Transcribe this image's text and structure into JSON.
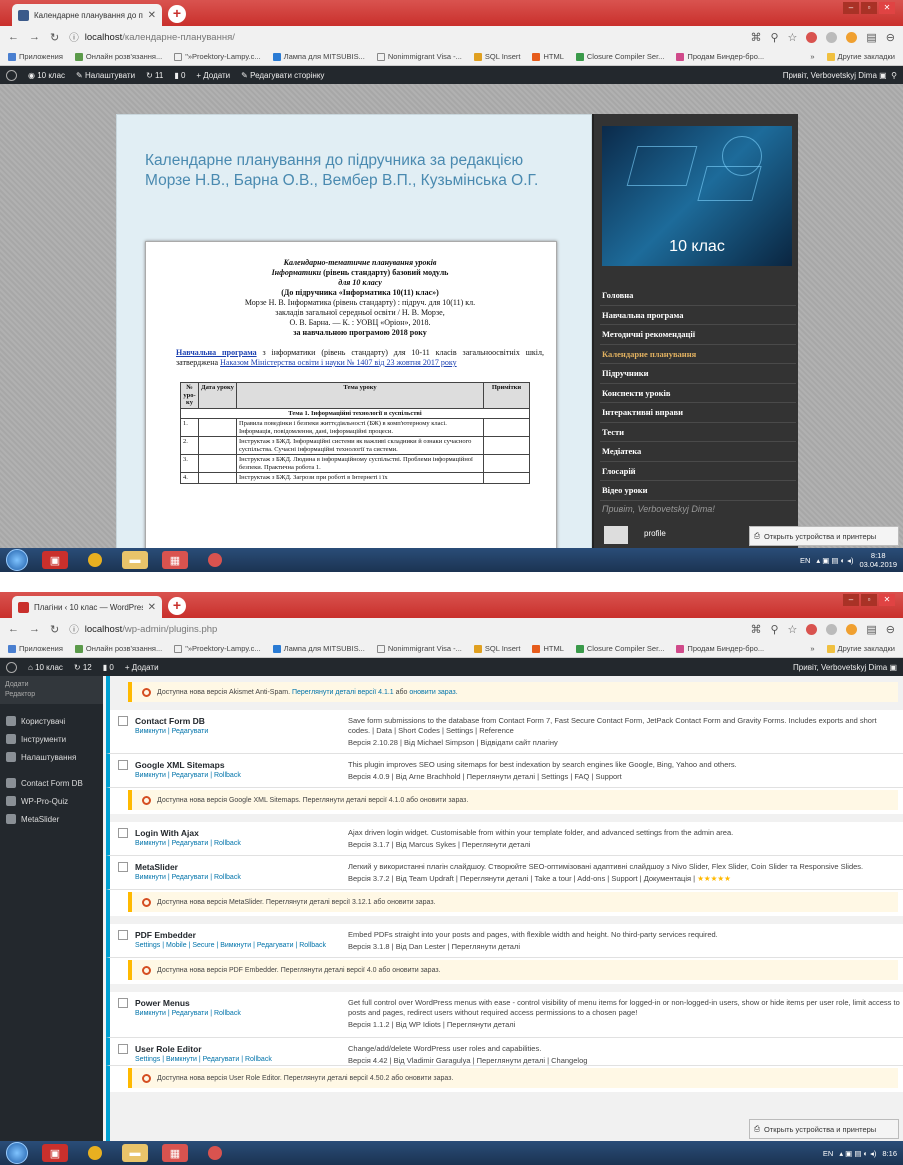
{
  "shot1": {
    "tab_title": "Календарне планування до підру...",
    "url_host": "localhost",
    "url_path": "/календарне-планування/",
    "bookmarks": [
      "Приложения",
      "Онлайн розв'язання...",
      "\"»Proektory-Lampy.c...",
      "Лампа для MITSUBIS...",
      "Nonimmigrant Visa -...",
      "SQL Insert",
      "HTML",
      "Closure Compiler Ser...",
      "Продам Биндер-бро...",
      "»",
      "Другие закладки"
    ],
    "adminbar": {
      "site": "10 клас",
      "customize": "Налаштувати",
      "updates": "11",
      "comments": "0",
      "new": "+ Додати",
      "edit": "Редагувати сторінку",
      "greeting": "Привіт, Verbovetskyj Dima"
    },
    "site_title": "Календарне планування до підручника за редакцією Морзе Н.В., Барна О.В., Вембер В.П., Кузьмінська О.Г.",
    "doc": {
      "h1": "Календарно-тематичне планування уроків",
      "h2a": "Інформатики",
      "h2b": " (рівень стандарту) базовий модуль",
      "h3": "для 10 класу",
      "h4": "(До підручника «Інформатика 10(11) клас»)",
      "h5": "Морзе Н. В. Інформатика (рівень стандарту) : підруч. для 10(11) кл.",
      "h6": "закладів загальної середньої освіти / Н. В. Морзе,",
      "h7": "О. В. Барна. — К. : УОВЦ «Оріон», 2018.",
      "h8": "за навчальною програмою 2018 року",
      "intro_link": "Навчальна програма",
      "intro_mid": " з інформатики (рівень стандарту) для 10-11 класів загальноосвітніх шкіл, затверджена ",
      "intro_link2": "Наказом Міністерства освіти і науки № 1407 від 23 жовтня 2017 року",
      "col1": "№ уро-ку",
      "col2": "Дата уроку",
      "col3": "Тема уроку",
      "col4": "Примітки",
      "section": "Тема 1. Інформаційні технології в суспільстві",
      "rows": [
        {
          "n": "1.",
          "t": "Правила поведінки і безпеки життєдіяльності (БЖ) в комп'ютерному класі. Інформація, повідомлення, дані, інформаційні процеси."
        },
        {
          "n": "2.",
          "t": "Інструктаж з БЖД. Інформаційні системи як важливі складники й ознаки сучасного суспільства. Сучасні інформаційні технології та системи."
        },
        {
          "n": "3.",
          "t": "Інструктаж з БЖД. Людина в інформаційному суспільстві. Проблеми інформаційної безпеки. Практична робота 1."
        },
        {
          "n": "4.",
          "t": "Інструктаж з БЖД. Загрози при роботі в Інтернеті і їх"
        }
      ]
    },
    "banner_label": "10 клас",
    "menu": [
      "Головна",
      "Навчальна програма",
      "Методичні рекомендації",
      "Календарне планування",
      "Підручники",
      "Конспекти уроків",
      "Інтерактивні вправи",
      "Тести",
      "Медіатека",
      "Глосарій",
      "Відео уроки"
    ],
    "menu_current": 3,
    "side_greeting": "Привіт, Verbovetskyj Dima!",
    "profile": "profile",
    "toast": "Открыть устройства и принтеры",
    "tray_lang": "EN",
    "clock_time": "8:18",
    "clock_date": "03.04.2019"
  },
  "shot2": {
    "tab_title": "Плагіни ‹ 10 клас — WordPress",
    "url_host": "localhost",
    "url_path": "/wp-admin/plugins.php",
    "adminbar": {
      "site": "10 клас",
      "updates": "12",
      "comments": "0",
      "new": "+ Додати",
      "greeting": "Привіт, Verbovetskyj Dima"
    },
    "sidebar_top": [
      "Додати",
      "Редактор"
    ],
    "sidebar": [
      "Користувачі",
      "Інструменти",
      "Налаштування",
      "Contact Form DB",
      "WP-Pro-Quiz",
      "MetaSlider"
    ],
    "notice_akismet": {
      "text": "Доступна нова версія Akismet Anti-Spam. ",
      "link": "Переглянути деталі версії 4.1.1",
      "tail": " або ",
      "link2": "оновити зараз."
    },
    "plugins": [
      {
        "name": "Contact Form DB",
        "actions": "Вимкнути | Редагувати",
        "desc": "Save form submissions to the database from Contact Form 7, Fast Secure Contact Form, JetPack Contact Form and Gravity Forms. Includes exports and short codes. | Data | Short Codes | Settings | Reference",
        "ver": "Версія 2.10.28 | Від Michael Simpson | Відвідати сайт плагіну"
      },
      {
        "name": "Google XML Sitemaps",
        "actions": "Вимкнути | Редагувати | Rollback",
        "desc": "This plugin improves SEO using sitemaps for best indexation by search engines like Google, Bing, Yahoo and others.",
        "ver": "Версія 4.0.9 | Від Arne Brachhold | Переглянути деталі | Settings | FAQ | Support",
        "notice": "Доступна нова версія Google XML Sitemaps. Переглянути деталі версії 4.1.0 або оновити зараз."
      },
      {
        "name": "Login With Ajax",
        "actions": "Вимкнути | Редагувати | Rollback",
        "desc": "Ajax driven login widget. Customisable from within your template folder, and advanced settings from the admin area.",
        "ver": "Версія 3.1.7 | Від Marcus Sykes | Переглянути деталі"
      },
      {
        "name": "MetaSlider",
        "actions": "Вимкнути | Редагувати | Rollback",
        "desc": "Легкий у використанні плагін слайдшоу. Створюйте SEO-оптимізовані адаптивні слайдшоу з Nivo Slider, Flex Slider, Coin Slider та Responsive Slides.",
        "ver": "Версія 3.7.2 | Від Team Updraft | Переглянути деталі | Take a tour | Add-ons | Support | Документація |",
        "stars": "★★★★★",
        "notice": "Доступна нова версія MetaSlider. Переглянути деталі версії 3.12.1 або оновити зараз."
      },
      {
        "name": "PDF Embedder",
        "actions": "Settings | Mobile | Secure | Вимкнути | Редагувати | Rollback",
        "desc": "Embed PDFs straight into your posts and pages, with flexible width and height. No third-party services required.",
        "ver": "Версія 3.1.8 | Від Dan Lester | Переглянути деталі",
        "notice": "Доступна нова версія PDF Embedder. Переглянути деталі версії 4.0 або оновити зараз."
      },
      {
        "name": "Power Menus",
        "actions": "Вимкнути | Редагувати | Rollback",
        "desc": "Get full control over WordPress menus with ease - control visibility of menu items for logged-in or non-logged-in users, show or hide items per user role, limit access to posts and pages, redirect users without required access permissions to a chosen page!",
        "ver": "Версія 1.1.2 | Від WP Idiots | Переглянути деталі"
      },
      {
        "name": "User Role Editor",
        "actions": "Settings | Вимкнути | Редагувати | Rollback",
        "desc": "Change/add/delete WordPress user roles and capabilities.",
        "ver": "Версія 4.42 | Від Vladimir Garagulya | Переглянути деталі | Changelog",
        "notice": "Доступна нова версія User Role Editor. Переглянути деталі версії 4.50.2 або оновити зараз."
      }
    ],
    "toast": "Открыть устройства и принтеры",
    "tray_lang": "EN",
    "clock_time": "8:16"
  },
  "colors": {
    "browser_red": "#c9302c",
    "wp_dark": "#23282d",
    "wp_blue": "#00a0d2",
    "notice_yellow": "#ffb900",
    "site_title": "#4a8ab0"
  }
}
